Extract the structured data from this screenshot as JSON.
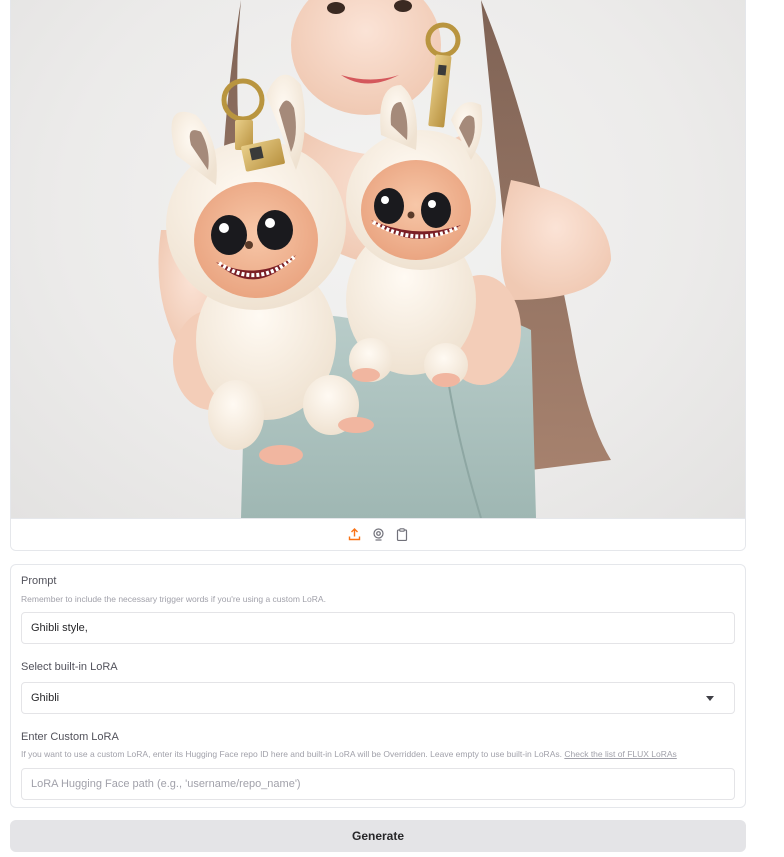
{
  "image": {
    "alt": "",
    "toolbar_icons": [
      "upload-icon",
      "webcam-icon",
      "clipboard-icon"
    ],
    "accent_color": "#f97316"
  },
  "prompt": {
    "label": "Prompt",
    "hint": "Remember to include the necessary trigger words if you're using a custom LoRA.",
    "value": "Ghibli style,"
  },
  "lora_select": {
    "label": "Select built-in LoRA",
    "selected": "Ghibli"
  },
  "custom_lora": {
    "label": "Enter Custom LoRA",
    "hint": "If you want to use a custom LoRA, enter its Hugging Face repo ID here and built-in LoRA will be Overridden. Leave empty to use built-in LoRAs.",
    "link_text": "Check the list of FLUX LoRAs",
    "placeholder": "LoRA Hugging Face path (e.g., 'username/repo_name')",
    "value": ""
  },
  "generate_button": {
    "label": "Generate"
  }
}
